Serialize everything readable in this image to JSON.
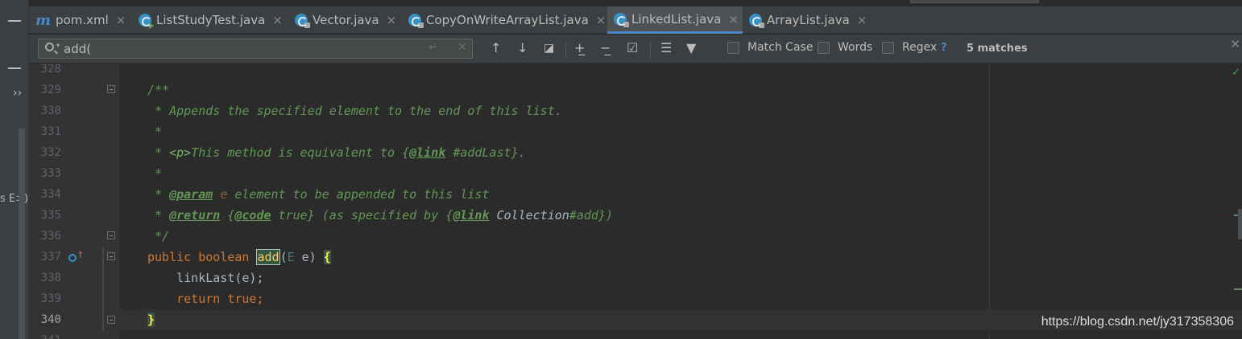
{
  "tabs": [
    {
      "name": "pom.xml",
      "icon": "maven-icon",
      "active": false
    },
    {
      "name": "ListStudyTest.java",
      "icon": "java-class-icon",
      "active": false
    },
    {
      "name": "Vector.java",
      "icon": "java-class-icon",
      "active": false
    },
    {
      "name": "CopyOnWriteArrayList.java",
      "icon": "java-class-icon",
      "active": false
    },
    {
      "name": "LinkedList.java",
      "icon": "java-class-icon",
      "active": true
    },
    {
      "name": "ArrayList.java",
      "icon": "java-class-icon",
      "active": false
    }
  ],
  "tab_close_glyph": "×",
  "maven_glyph": "m",
  "left_strip": {
    "expand_glyph": "››",
    "clipped_text": "s E>)"
  },
  "find": {
    "query": "add(",
    "match_case_label": "Match Case",
    "words_label": "Words",
    "regex_label": "Regex",
    "help_glyph": "?",
    "matches_text": "5 matches",
    "match_case_checked": false,
    "words_checked": false,
    "regex_checked": false
  },
  "editor": {
    "lines": [
      {
        "num": "328"
      },
      {
        "num": "329"
      },
      {
        "num": "330"
      },
      {
        "num": "331"
      },
      {
        "num": "332"
      },
      {
        "num": "333"
      },
      {
        "num": "334"
      },
      {
        "num": "335"
      },
      {
        "num": "336"
      },
      {
        "num": "337"
      },
      {
        "num": "338"
      },
      {
        "num": "339"
      },
      {
        "num": "340"
      },
      {
        "num": "341"
      }
    ],
    "current_line": "340",
    "code": {
      "l329": "/**",
      "l330": " * Appends the specified element to the end of this list.",
      "l331": " *",
      "l332_a": " * ",
      "l332_p": "<p>",
      "l332_b": "This method is equivalent to {",
      "l332_tag": "@link",
      "l332_c": " ",
      "l332_ref": "#addLast",
      "l332_d": "}.",
      "l333": " *",
      "l334_a": " * ",
      "l334_tag": "@param",
      "l334_b": " ",
      "l334_param": "e",
      "l334_c": " element to be appended to this list",
      "l335_a": " * ",
      "l335_tag": "@return",
      "l335_b": " {",
      "l335_code": "@code",
      "l335_c": " true} (as specified by {",
      "l335_link": "@link",
      "l335_d": " ",
      "l335_ref": "Collection",
      "l335_e": "#add})",
      "l336": " */",
      "l337_public": "public",
      "l337_boolean": "boolean",
      "l337_match": "add",
      "l337_paren": "(",
      "l337_type": "E",
      "l337_rest": " e) ",
      "l337_brace": "{",
      "l338": "    linkLast(e);",
      "l339_kw": "    return",
      "l339_val": " true",
      "l339_semi": ";",
      "l340_brace": "}"
    }
  },
  "watermark": "https://blog.csdn.net/jy317358306",
  "colors": {
    "accent": "#4a88c7",
    "comment": "#629755",
    "keyword": "#cc7832",
    "background": "#2b2b2b"
  }
}
